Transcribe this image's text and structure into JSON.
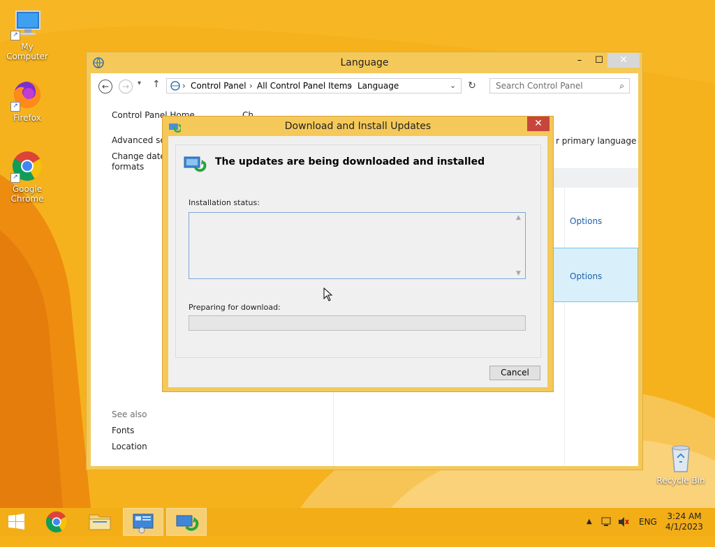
{
  "desktop": {
    "icons": [
      {
        "label": "My Computer"
      },
      {
        "label": "Firefox"
      },
      {
        "label": "Google Chrome"
      },
      {
        "label": "Recycle Bin"
      }
    ]
  },
  "window": {
    "title": "Language",
    "breadcrumb": [
      "Control Panel",
      "All Control Panel Items",
      "Language"
    ],
    "search_placeholder": "Search Control Panel",
    "sidebar": {
      "home": "Control Panel Home",
      "advanced": "Advanced set",
      "change_date": "Change date,",
      "formats": "formats",
      "see_also": "See also",
      "fonts": "Fonts",
      "location": "Location"
    },
    "main": {
      "partial_heading": "Ch",
      "partial_text_right": "r primary language",
      "options_1": "Options",
      "options_2": "Options"
    },
    "controls": {
      "minimize": "–",
      "maximize": "☐",
      "close": "✕"
    }
  },
  "dialog": {
    "title": "Download and Install Updates",
    "heading": "The updates are being downloaded and installed",
    "status_label": "Installation status:",
    "status_text": "",
    "progress_label": "Preparing for download:",
    "progress_value": 0,
    "cancel_label": "Cancel",
    "close": "✕"
  },
  "taskbar": {
    "language": "ENG",
    "time": "3:24 AM",
    "date": "4/1/2023"
  },
  "colors": {
    "accent": "#f4c95a",
    "desktop": "#f6b018",
    "taskbar": "#f2ad17",
    "link": "#1e5fa8",
    "progress": "#06b025"
  }
}
